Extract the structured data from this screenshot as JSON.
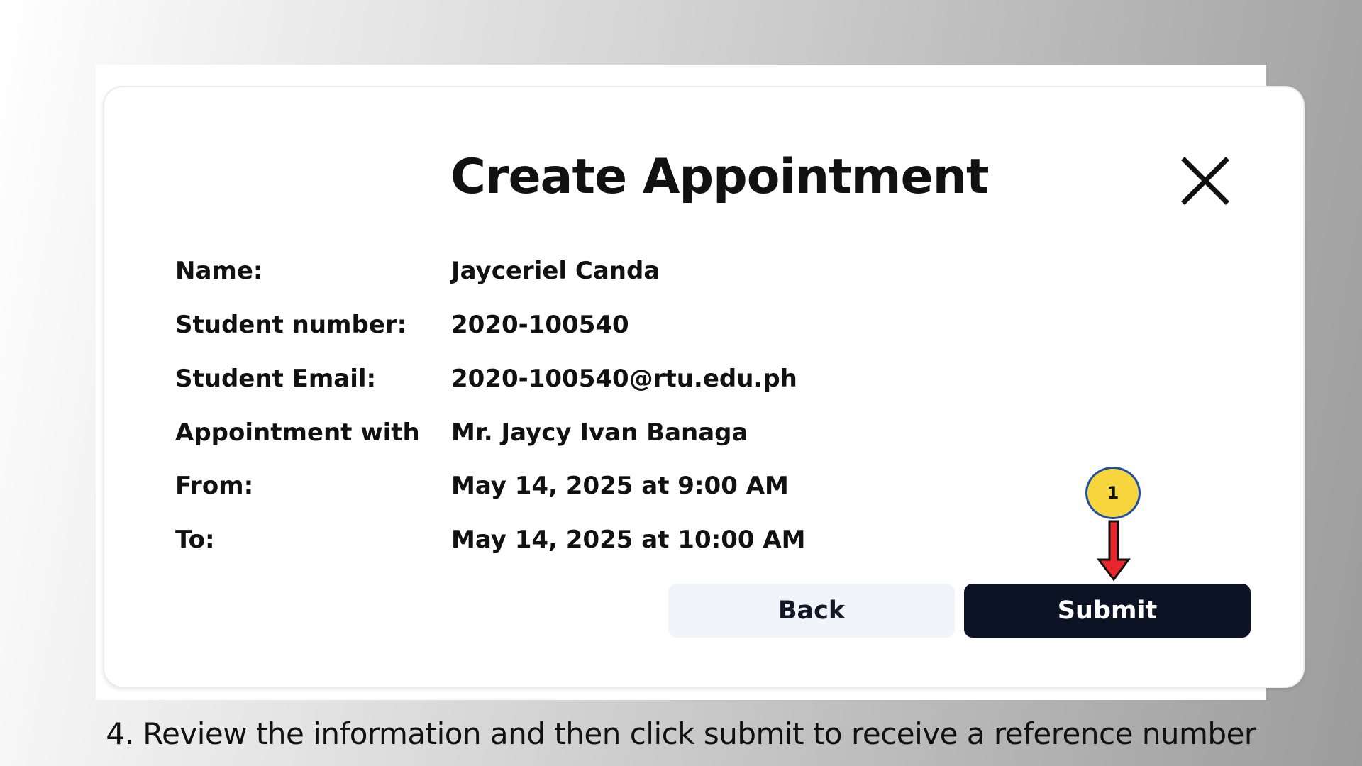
{
  "dialog": {
    "title": "Create Appointment",
    "close_icon": "close-icon",
    "fields": [
      {
        "label": "Name:",
        "value": "Jayceriel Canda"
      },
      {
        "label": "Student number:",
        "value": "2020-100540"
      },
      {
        "label": "Student Email:",
        "value": "2020-100540@rtu.edu.ph"
      },
      {
        "label": "Appointment with",
        "value": "Mr. Jaycy Ivan Banaga"
      },
      {
        "label": "From:",
        "value": "May 14, 2025 at 9:00 AM"
      },
      {
        "label": "To:",
        "value": "May 14, 2025 at 10:00 AM"
      }
    ],
    "back_label": "Back",
    "submit_label": "Submit"
  },
  "annotation": {
    "step_number": "1",
    "arrow_icon": "arrow-down-icon",
    "colors": {
      "badge_fill": "#f6d63c",
      "badge_border": "#1f4fa8",
      "arrow": "#e8262b"
    }
  },
  "caption": "4. Review the information and then click submit to receive a reference number",
  "colors": {
    "submit_bg": "#0b1324",
    "back_bg": "#f1f4f8",
    "text": "#111111"
  }
}
